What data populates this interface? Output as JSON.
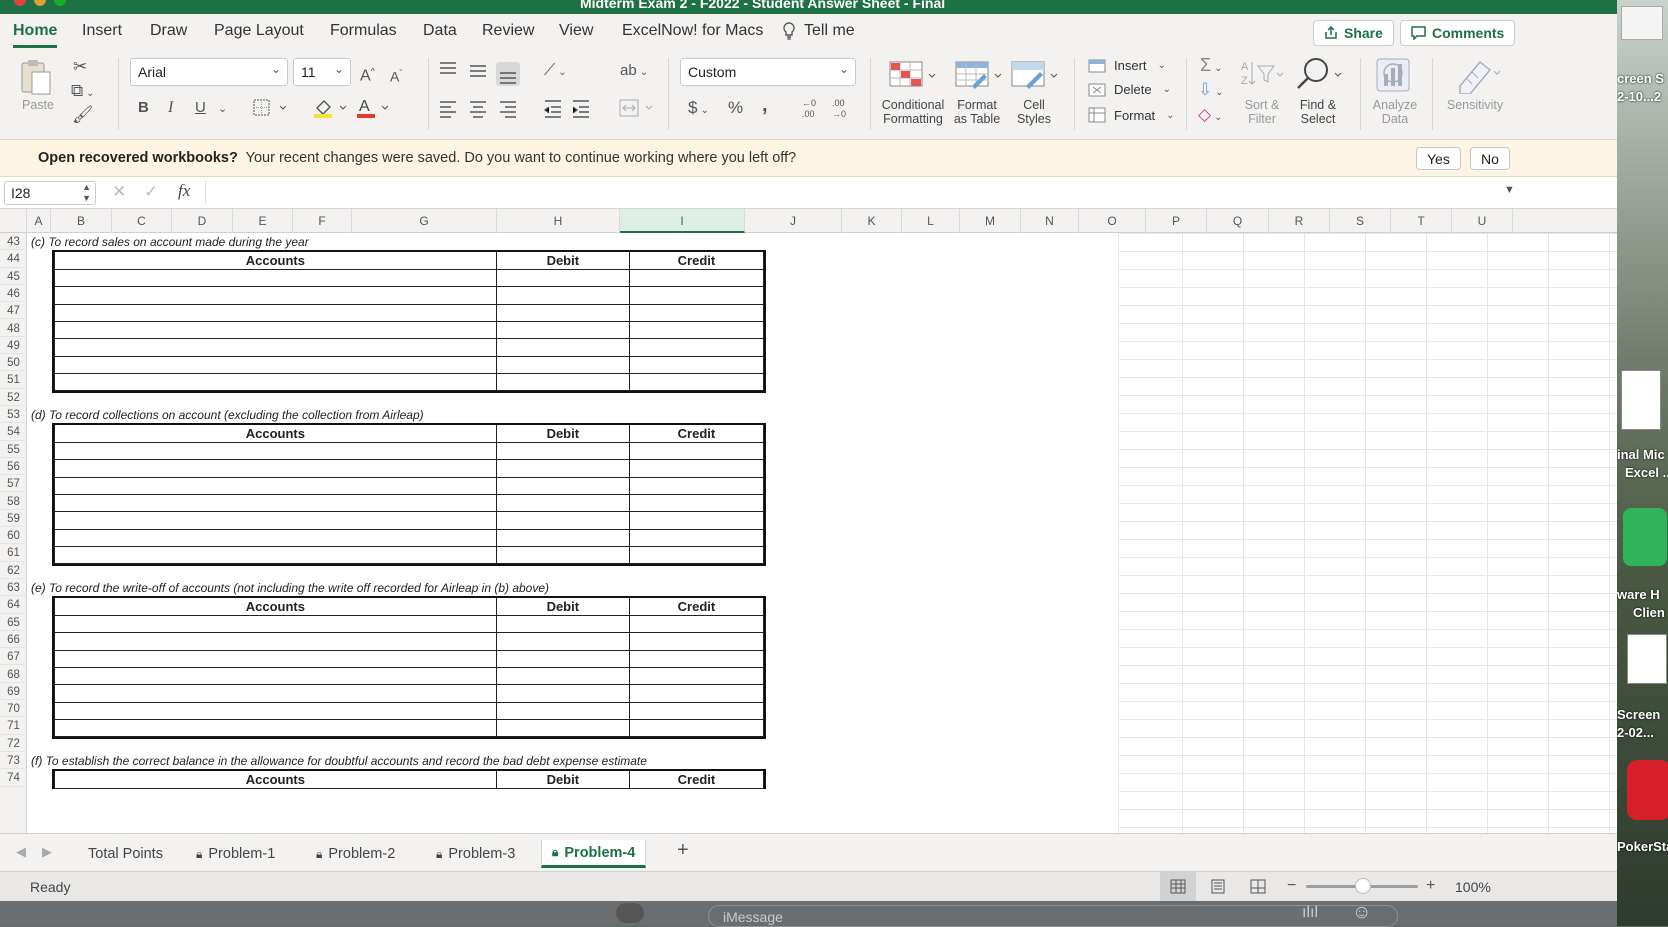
{
  "window": {
    "title": "Midterm Exam 2 - F2022 - Student Answer Sheet - Final"
  },
  "menu": {
    "tabs": [
      "Home",
      "Insert",
      "Draw",
      "Page Layout",
      "Formulas",
      "Data",
      "Review",
      "View",
      "ExcelNow! for Macs"
    ],
    "tell_me": "Tell me",
    "share": "Share",
    "comments": "Comments"
  },
  "ribbon": {
    "paste": "Paste",
    "font_name": "Arial",
    "font_size": "11",
    "number_format": "Custom",
    "conditional_formatting": "Conditional\nFormatting",
    "format_as_table": "Format\nas Table",
    "cell_styles": "Cell\nStyles",
    "insert": "Insert",
    "delete": "Delete",
    "format": "Format",
    "sort_filter": "Sort &\nFilter",
    "find_select": "Find &\nSelect",
    "analyze_data": "Analyze\nData",
    "sensitivity": "Sensitivity",
    "bold": "B",
    "italic": "I",
    "underline": "U",
    "currency": "$",
    "percent": "%",
    "comma": ",",
    "icons": [
      "cut-icon",
      "copy-icon",
      "format-painter-icon",
      "borders-icon",
      "fill-color-icon",
      "font-color-icon",
      "align-icons",
      "wrap-icon",
      "merge-icon",
      "autosum-icon",
      "fill-icon",
      "clear-icon"
    ]
  },
  "notification": {
    "title": "Open recovered workbooks?",
    "text": "Your recent changes were saved. Do you want to continue working where you left off?",
    "yes": "Yes",
    "no": "No"
  },
  "formula_bar": {
    "cell": "I28",
    "fx": "fx",
    "content": ""
  },
  "columns": [
    "A",
    "B",
    "C",
    "D",
    "E",
    "F",
    "G",
    "H",
    "I",
    "J",
    "K",
    "L",
    "M",
    "N",
    "O",
    "P",
    "Q",
    "R",
    "S",
    "T",
    "U"
  ],
  "active_column": "I",
  "rows": [
    "43",
    "44",
    "45",
    "46",
    "47",
    "48",
    "49",
    "50",
    "51",
    "52",
    "53",
    "54",
    "55",
    "56",
    "57",
    "58",
    "59",
    "60",
    "61",
    "62",
    "63",
    "64",
    "65",
    "66",
    "67",
    "68",
    "69",
    "70",
    "71",
    "72",
    "73",
    "74"
  ],
  "sections": [
    {
      "caption": "(c) To record sales on account  made during the year",
      "headers": [
        "Accounts",
        "Debit",
        "Credit"
      ],
      "blank_rows": 7
    },
    {
      "caption": "(d) To record collections on account (excluding the collection from Airleap)",
      "headers": [
        "Accounts",
        "Debit",
        "Credit"
      ],
      "blank_rows": 7
    },
    {
      "caption": "(e) To record the write-off of accounts (not including the write off recorded for Airleap in (b) above)",
      "headers": [
        "Accounts",
        "Debit",
        "Credit"
      ],
      "blank_rows": 7
    },
    {
      "caption": "(f) To establish the correct balance in the allowance for doubtful accounts and record the bad debt expense estimate",
      "headers": [
        "Accounts",
        "Debit",
        "Credit"
      ],
      "blank_rows": 0
    }
  ],
  "sheets": {
    "tabs": [
      "Total Points",
      "Problem-1",
      "Problem-2",
      "Problem-3",
      "Problem-4"
    ],
    "active": "Problem-4",
    "add": "+"
  },
  "status": {
    "ready": "Ready",
    "zoom": "100%"
  },
  "desktop_labels": [
    "creen S",
    "2-10...2",
    "inal Mic",
    "Excel ...",
    "ware H",
    "Clien",
    "Screen",
    "2-02...",
    "PokerSta"
  ],
  "dock": {
    "imessage_placeholder": "iMessage"
  }
}
